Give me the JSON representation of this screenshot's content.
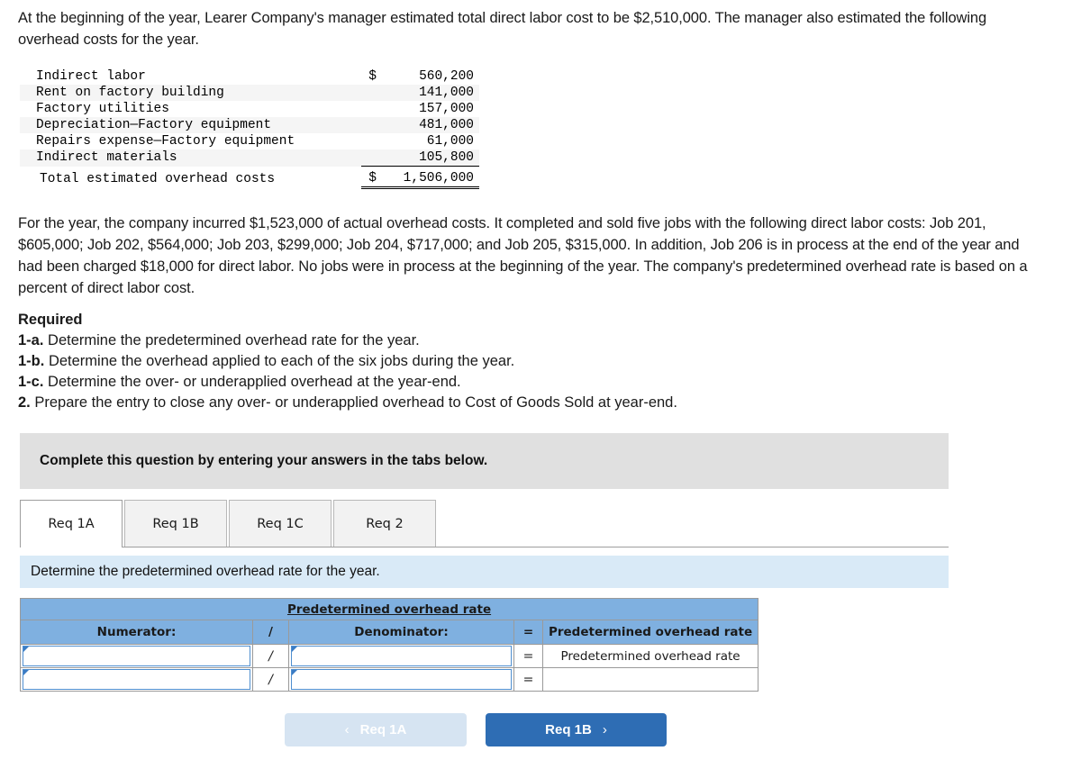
{
  "intro": {
    "paragraph": "At the beginning of the year, Learer Company's manager estimated total direct labor cost to be $2,510,000. The manager also estimated the following overhead costs for the year."
  },
  "overhead_table": {
    "rows": [
      {
        "label": "Indirect labor",
        "currency": "$",
        "amount": "560,200"
      },
      {
        "label": "Rent on factory building",
        "currency": "",
        "amount": "141,000"
      },
      {
        "label": "Factory utilities",
        "currency": "",
        "amount": "157,000"
      },
      {
        "label": "Depreciation—Factory equipment",
        "currency": "",
        "amount": "481,000"
      },
      {
        "label": "Repairs expense—Factory equipment",
        "currency": "",
        "amount": "61,000"
      },
      {
        "label": "Indirect materials",
        "currency": "",
        "amount": "105,800"
      }
    ],
    "total": {
      "label": "Total estimated overhead costs",
      "currency": "$",
      "amount": "1,506,000"
    }
  },
  "facts": {
    "paragraph": "For the year, the company incurred $1,523,000 of actual overhead costs. It completed and sold five jobs with the following direct labor costs: Job 201, $605,000; Job 202, $564,000; Job 203, $299,000; Job 204, $717,000; and Job 205, $315,000. In addition, Job 206 is in process at the end of the year and had been charged $18,000 for direct labor. No jobs were in process at the beginning of the year. The company's predetermined overhead rate is based on a percent of direct labor cost."
  },
  "required": {
    "heading": "Required",
    "items": [
      {
        "num": "1-a.",
        "text": "Determine the predetermined overhead rate for the year."
      },
      {
        "num": "1-b.",
        "text": "Determine the overhead applied to each of the six jobs during the year."
      },
      {
        "num": "1-c.",
        "text": "Determine the over- or underapplied overhead at the year-end."
      },
      {
        "num": "2.",
        "text": "Prepare the entry to close any over- or underapplied overhead to Cost of Goods Sold at year-end."
      }
    ]
  },
  "instruction_banner": {
    "text": "Complete this question by entering your answers in the tabs below."
  },
  "tabs": [
    {
      "label": "Req 1A",
      "active": true
    },
    {
      "label": "Req 1B",
      "active": false
    },
    {
      "label": "Req 1C",
      "active": false
    },
    {
      "label": "Req 2",
      "active": false
    }
  ],
  "sub_instruction": {
    "text": "Determine the predetermined overhead rate for the year."
  },
  "answer_table": {
    "title": "Predetermined overhead rate",
    "headers": {
      "numerator": "Numerator:",
      "divide": "/",
      "denominator": "Denominator:",
      "equals": "=",
      "result": "Predetermined overhead rate"
    },
    "rows": [
      {
        "numerator_value": "",
        "divide": "/",
        "denominator_value": "",
        "equals": "=",
        "result": "Predetermined overhead rate"
      },
      {
        "numerator_value": "",
        "divide": "/",
        "denominator_value": "",
        "equals": "=",
        "result": ""
      }
    ]
  },
  "nav": {
    "prev": {
      "label": "Req 1A",
      "chevron": "‹",
      "disabled": true
    },
    "next": {
      "label": "Req 1B",
      "chevron": "›",
      "disabled": false
    }
  },
  "colors": {
    "header_blue": "#7fb0e0",
    "banner_gray": "#e0e0e0",
    "banner_blue": "#d9eaf7",
    "button_active": "#2e6db4",
    "button_disabled": "#d6e4f2"
  }
}
